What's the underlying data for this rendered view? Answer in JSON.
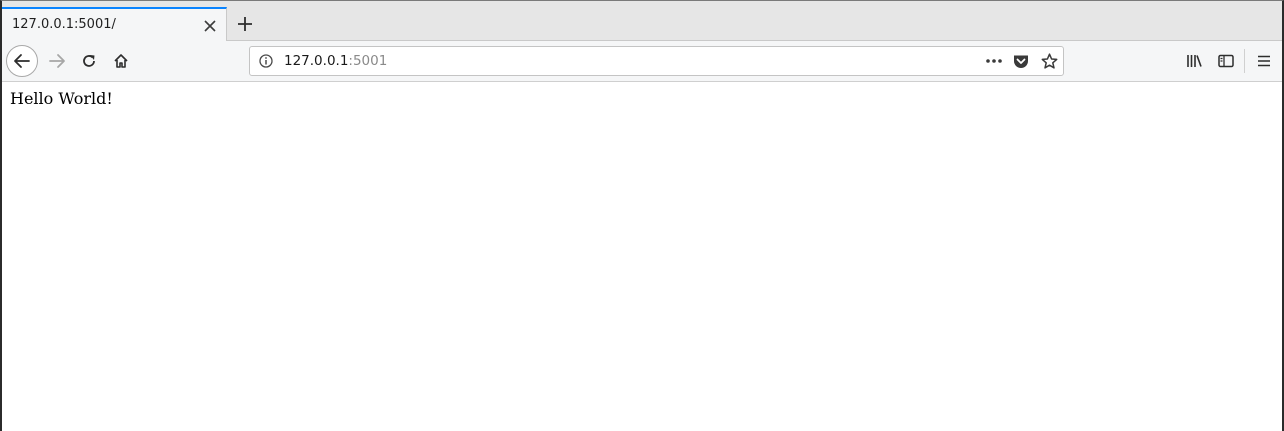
{
  "browser": {
    "tab": {
      "title": "127.0.0.1:5001/",
      "close_icon": "close-icon"
    },
    "new_tab_icon": "plus-icon",
    "nav": {
      "back_icon": "arrow-left-icon",
      "forward_icon": "arrow-right-icon",
      "reload_icon": "reload-icon",
      "home_icon": "home-icon"
    },
    "urlbar": {
      "host": "127.0.0.1",
      "port": ":5001",
      "info_icon": "info-icon",
      "more_icon": "more-dots-icon",
      "pocket_icon": "pocket-icon",
      "bookmark_icon": "star-icon"
    },
    "toolbar": {
      "library_icon": "library-icon",
      "sidebar_icon": "sidebar-icon",
      "menu_icon": "hamburger-menu-icon"
    },
    "colors": {
      "active_tab_accent": "#0a84ff",
      "chrome_bg": "#e6e6e6",
      "toolbar_bg": "#f5f6f7"
    }
  },
  "page": {
    "body_text": "Hello World!"
  }
}
